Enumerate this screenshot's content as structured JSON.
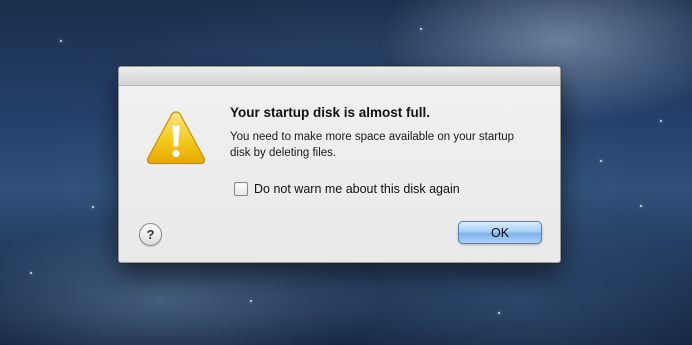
{
  "dialog": {
    "headline": "Your startup disk is almost full.",
    "message": "You need to make more space available on your startup disk by deleting files.",
    "checkbox": {
      "label": "Do not warn me about this disk again",
      "checked": false
    },
    "help_button_label": "?",
    "ok_button_label": "OK",
    "icon": "warning-triangle-icon"
  },
  "colors": {
    "ok_button": "#7fb3ec",
    "warning_icon": "#f2c40f"
  }
}
